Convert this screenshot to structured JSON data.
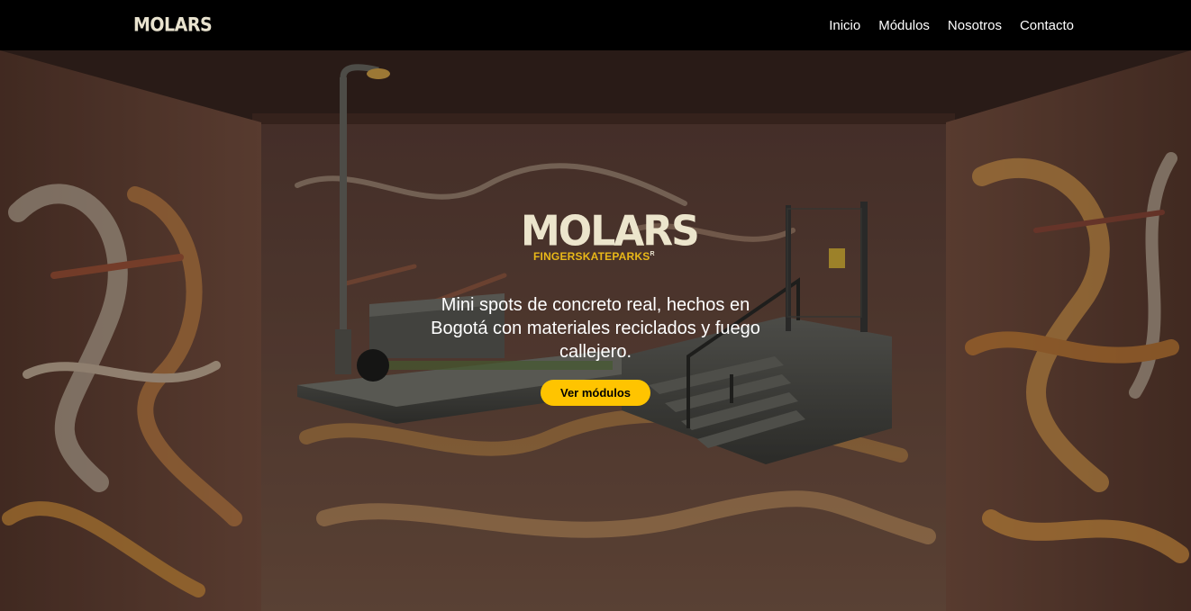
{
  "nav": {
    "logo": "MOLARS",
    "links": [
      "Inicio",
      "Módulos",
      "Nosotros",
      "Contacto"
    ]
  },
  "hero": {
    "brand_name": "MOLARS",
    "brand_sub": "FINGERSKATEPARKS",
    "brand_mark": "R",
    "tagline": "Mini spots de concreto real, hechos en Bogotá con materiales reciclados y fuego callejero.",
    "cta_label": "Ver módulos"
  },
  "colors": {
    "navbar_bg": "#000000",
    "accent": "#ffc400",
    "logo_cream": "#ece5cc",
    "sub_yellow": "#e9b818"
  }
}
